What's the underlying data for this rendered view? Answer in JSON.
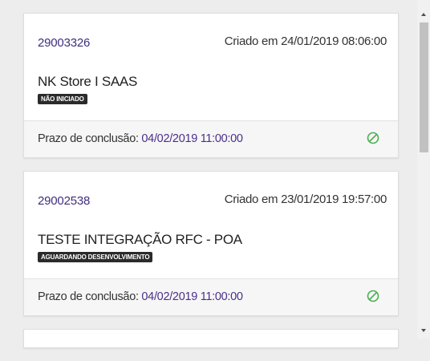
{
  "deadline_label": "Prazo de conclusão:",
  "cards": [
    {
      "id": "29003326",
      "created": "Criado em 24/01/2019 08:06:00",
      "title": "NK Store I SAAS",
      "status": "NÃO INICIADO",
      "deadline": "04/02/2019 11:00:00",
      "icon": "no-entry-icon"
    },
    {
      "id": "29002538",
      "created": "Criado em 23/01/2019 19:57:00",
      "title": "TESTE INTEGRAÇÃO RFC - POA",
      "status": "AGUARDANDO DESENVOLVIMENTO",
      "deadline": "04/02/2019 11:00:00",
      "icon": "no-entry-icon"
    }
  ],
  "colors": {
    "id_link": "#3f2e7d",
    "deadline_value": "#4a2f8a",
    "icon_green": "#4caf50",
    "badge_bg": "#2b2b2b"
  }
}
